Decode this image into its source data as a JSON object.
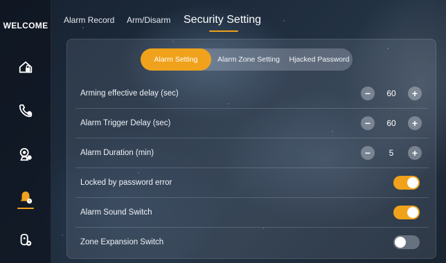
{
  "sidebar": {
    "welcome": "WELCOME",
    "items": [
      {
        "icon": "home-lock-icon"
      },
      {
        "icon": "phone-call-icon"
      },
      {
        "icon": "camera-person-icon"
      },
      {
        "icon": "alarm-bell-icon",
        "active": true
      },
      {
        "icon": "intercom-settings-icon"
      }
    ],
    "accent": "#f0a21c"
  },
  "tabs": [
    {
      "label": "Alarm Record"
    },
    {
      "label": "Arm/Disarm"
    },
    {
      "label": "Security Setting",
      "active": true
    }
  ],
  "segments": [
    {
      "label": "Alarm Setting",
      "active": true
    },
    {
      "label": "Alarm Zone Setting"
    },
    {
      "label": "Hjacked Password"
    }
  ],
  "settings": [
    {
      "label": "Arming effective delay (sec)",
      "type": "stepper",
      "value": "60",
      "minus": "−",
      "plus": "+"
    },
    {
      "label": "Alarm Trigger Delay (sec)",
      "type": "stepper",
      "value": "60",
      "minus": "−",
      "plus": "+"
    },
    {
      "label": "Alarm Duration (min)",
      "type": "stepper",
      "value": "5",
      "minus": "−",
      "plus": "+"
    },
    {
      "label": "Locked by password error",
      "type": "toggle",
      "on": true
    },
    {
      "label": "Alarm Sound Switch",
      "type": "toggle",
      "on": true
    },
    {
      "label": "Zone Expansion Switch",
      "type": "toggle",
      "on": false
    }
  ]
}
